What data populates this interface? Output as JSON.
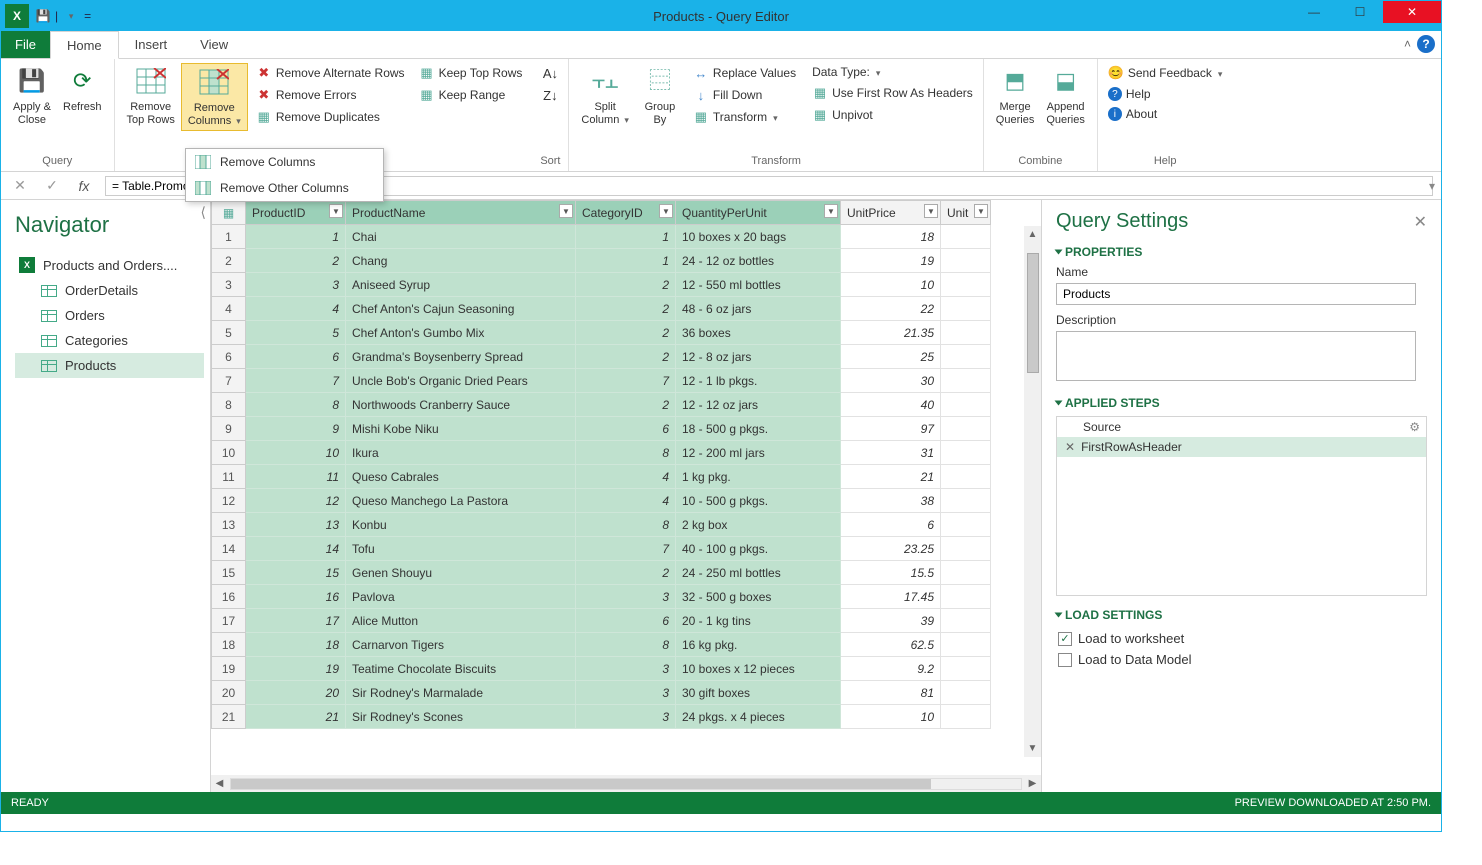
{
  "window": {
    "title": "Products - Query Editor",
    "qat": [
      "save",
      "undo",
      "redo"
    ]
  },
  "menubar": {
    "file": "File",
    "tabs": [
      "Home",
      "Insert",
      "View"
    ],
    "active": "Home"
  },
  "ribbon": {
    "query": {
      "label": "Query",
      "applyClose": "Apply &\nClose",
      "refresh": "Refresh"
    },
    "removeTopRows": "Remove\nTop Rows",
    "removeColumns": "Remove\nColumns",
    "reduce": {
      "removeAlternate": "Remove Alternate Rows",
      "removeErrors": "Remove Errors",
      "removeDuplicates": "Remove Duplicates",
      "keepTop": "Keep Top Rows",
      "keepRange": "Keep Range"
    },
    "sort": {
      "label": "Sort"
    },
    "splitColumn": "Split\nColumn",
    "groupBy": "Group\nBy",
    "transform": {
      "label": "Transform",
      "replace": "Replace Values",
      "fillDown": "Fill Down",
      "transform": "Transform",
      "dataType": "Data Type:",
      "firstRow": "Use First Row As Headers",
      "unpivot": "Unpivot"
    },
    "combine": {
      "label": "Combine",
      "merge": "Merge\nQueries",
      "append": "Append\nQueries"
    },
    "help": {
      "label": "Help",
      "feedback": "Send Feedback",
      "helpItem": "Help",
      "about": "About"
    }
  },
  "dropdown": {
    "item1": "Remove Columns",
    "item2": "Remove Other Columns"
  },
  "formula": {
    "text": "= Table.PromoteHeaders(Products)"
  },
  "navigator": {
    "title": "Navigator",
    "root": "Products and Orders....",
    "items": [
      "OrderDetails",
      "Orders",
      "Categories",
      "Products"
    ],
    "selected": "Products"
  },
  "table": {
    "columns": [
      "ProductID",
      "ProductName",
      "CategoryID",
      "QuantityPerUnit",
      "UnitPrice",
      "Unit"
    ],
    "selectedCols": [
      0,
      1,
      2,
      3
    ],
    "rows": [
      {
        "n": 1,
        "id": 1,
        "name": "Chai",
        "cat": 1,
        "qpu": "10 boxes x 20 bags",
        "price": "18"
      },
      {
        "n": 2,
        "id": 2,
        "name": "Chang",
        "cat": 1,
        "qpu": "24 - 12 oz bottles",
        "price": "19"
      },
      {
        "n": 3,
        "id": 3,
        "name": "Aniseed Syrup",
        "cat": 2,
        "qpu": "12 - 550 ml bottles",
        "price": "10"
      },
      {
        "n": 4,
        "id": 4,
        "name": "Chef Anton's Cajun Seasoning",
        "cat": 2,
        "qpu": "48 - 6 oz jars",
        "price": "22"
      },
      {
        "n": 5,
        "id": 5,
        "name": "Chef Anton's Gumbo Mix",
        "cat": 2,
        "qpu": "36 boxes",
        "price": "21.35"
      },
      {
        "n": 6,
        "id": 6,
        "name": "Grandma's Boysenberry Spread",
        "cat": 2,
        "qpu": "12 - 8 oz jars",
        "price": "25"
      },
      {
        "n": 7,
        "id": 7,
        "name": "Uncle Bob's Organic Dried Pears",
        "cat": 7,
        "qpu": "12 - 1 lb pkgs.",
        "price": "30"
      },
      {
        "n": 8,
        "id": 8,
        "name": "Northwoods Cranberry Sauce",
        "cat": 2,
        "qpu": "12 - 12 oz jars",
        "price": "40"
      },
      {
        "n": 9,
        "id": 9,
        "name": "Mishi Kobe Niku",
        "cat": 6,
        "qpu": "18 - 500 g pkgs.",
        "price": "97"
      },
      {
        "n": 10,
        "id": 10,
        "name": "Ikura",
        "cat": 8,
        "qpu": "12 - 200 ml jars",
        "price": "31"
      },
      {
        "n": 11,
        "id": 11,
        "name": "Queso Cabrales",
        "cat": 4,
        "qpu": "1 kg pkg.",
        "price": "21"
      },
      {
        "n": 12,
        "id": 12,
        "name": "Queso Manchego La Pastora",
        "cat": 4,
        "qpu": "10 - 500 g pkgs.",
        "price": "38"
      },
      {
        "n": 13,
        "id": 13,
        "name": "Konbu",
        "cat": 8,
        "qpu": "2 kg box",
        "price": "6"
      },
      {
        "n": 14,
        "id": 14,
        "name": "Tofu",
        "cat": 7,
        "qpu": "40 - 100 g pkgs.",
        "price": "23.25"
      },
      {
        "n": 15,
        "id": 15,
        "name": "Genen Shouyu",
        "cat": 2,
        "qpu": "24 - 250 ml bottles",
        "price": "15.5"
      },
      {
        "n": 16,
        "id": 16,
        "name": "Pavlova",
        "cat": 3,
        "qpu": "32 - 500 g boxes",
        "price": "17.45"
      },
      {
        "n": 17,
        "id": 17,
        "name": "Alice Mutton",
        "cat": 6,
        "qpu": "20 - 1 kg tins",
        "price": "39"
      },
      {
        "n": 18,
        "id": 18,
        "name": "Carnarvon Tigers",
        "cat": 8,
        "qpu": "16 kg pkg.",
        "price": "62.5"
      },
      {
        "n": 19,
        "id": 19,
        "name": "Teatime Chocolate Biscuits",
        "cat": 3,
        "qpu": "10 boxes x 12 pieces",
        "price": "9.2"
      },
      {
        "n": 20,
        "id": 20,
        "name": "Sir Rodney's Marmalade",
        "cat": 3,
        "qpu": "30 gift boxes",
        "price": "81"
      },
      {
        "n": 21,
        "id": 21,
        "name": "Sir Rodney's Scones",
        "cat": 3,
        "qpu": "24 pkgs. x 4 pieces",
        "price": "10"
      }
    ]
  },
  "settings": {
    "title": "Query Settings",
    "properties": "PROPERTIES",
    "nameLabel": "Name",
    "nameValue": "Products",
    "descLabel": "Description",
    "applied": "APPLIED STEPS",
    "steps": [
      "Source",
      "FirstRowAsHeader"
    ],
    "selectedStep": "FirstRowAsHeader",
    "loadSettings": "LOAD SETTINGS",
    "loadWorksheet": "Load to worksheet",
    "loadDataModel": "Load to Data Model"
  },
  "status": {
    "ready": "READY",
    "right": "PREVIEW DOWNLOADED AT 2:50 PM."
  }
}
